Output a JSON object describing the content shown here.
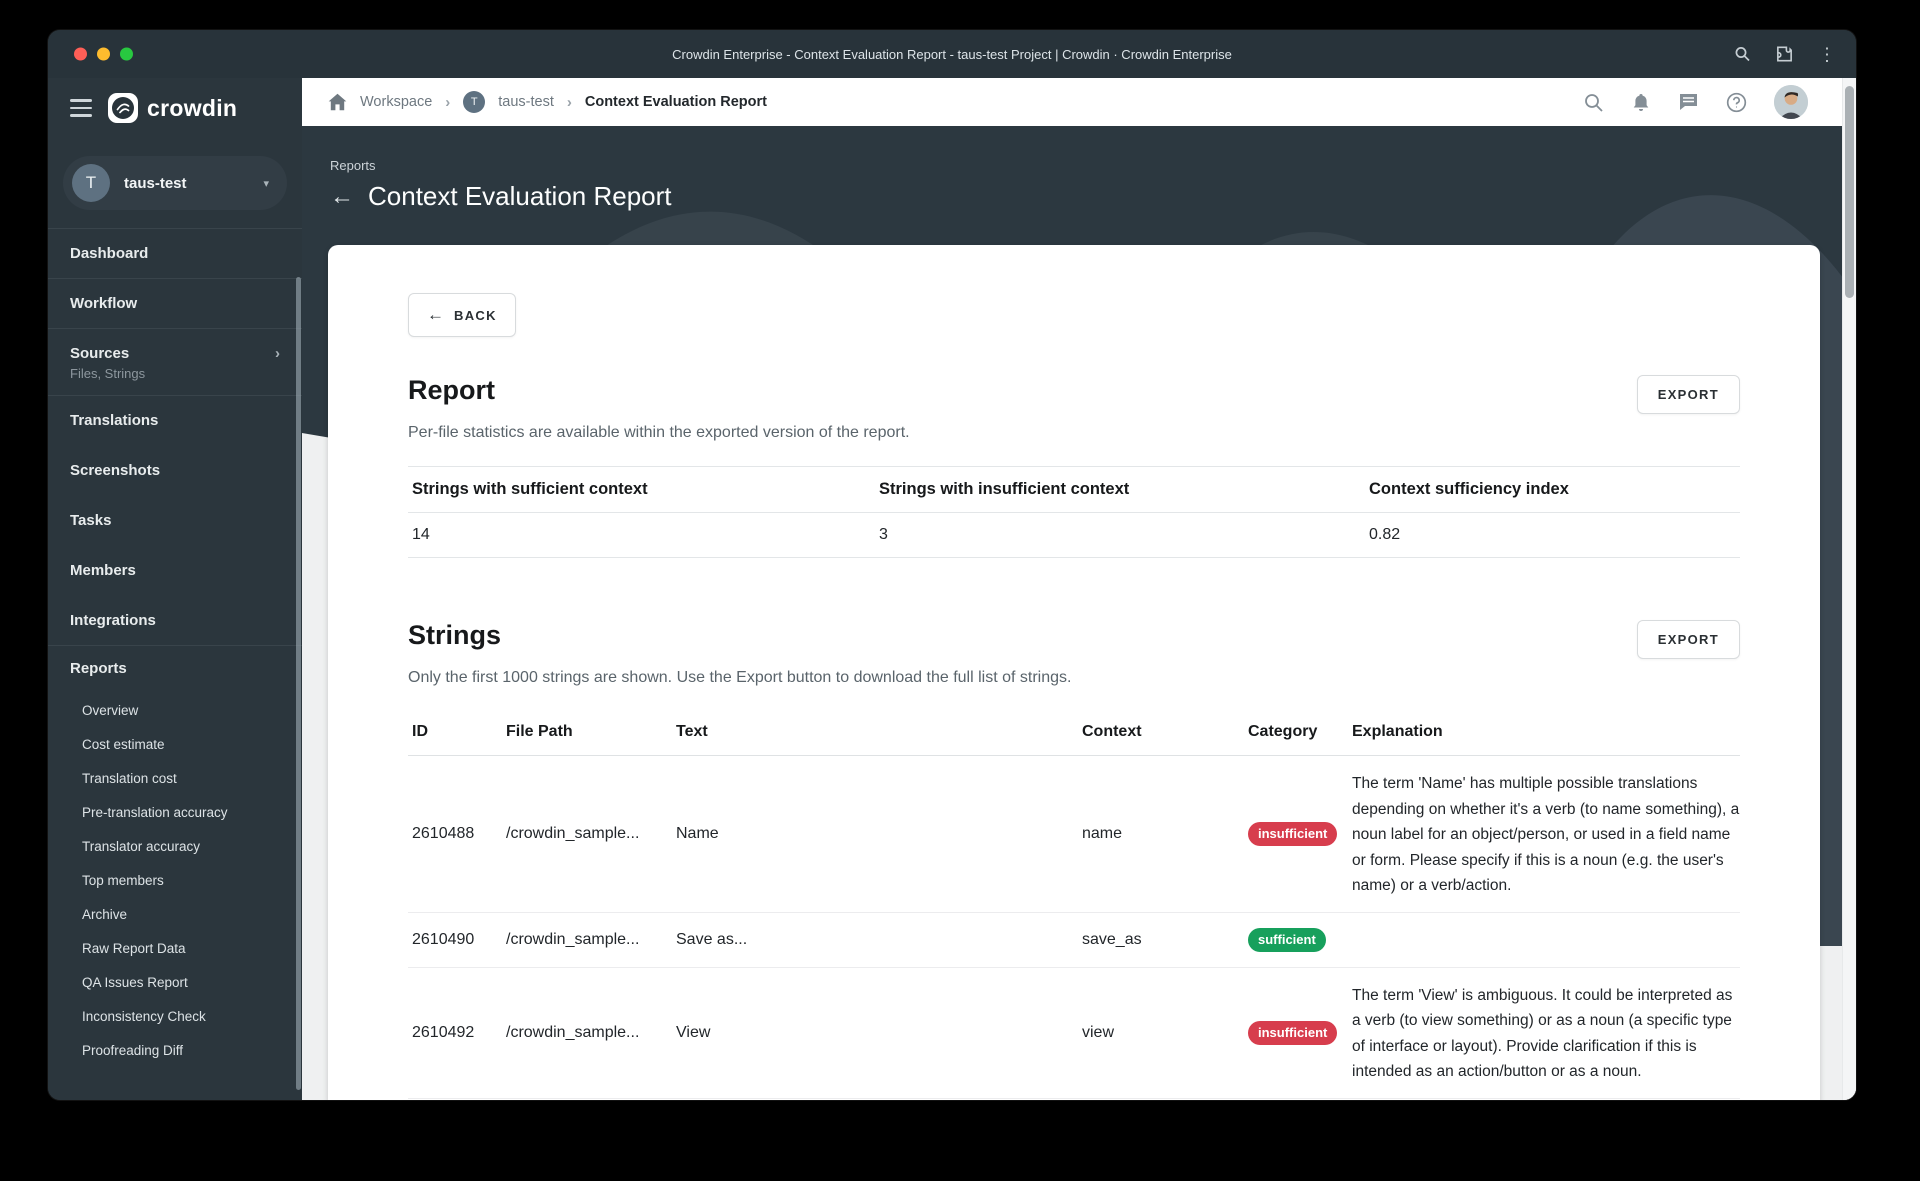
{
  "window": {
    "title": "Crowdin Enterprise - Context Evaluation Report - taus-test Project | Crowdin · Crowdin Enterprise"
  },
  "icons": {
    "kebab": "⋮",
    "caret_down": "▾",
    "chevron_right": "›",
    "back_arrow": "←"
  },
  "colors": {
    "titlebar_bg": "#28333a",
    "sidebar_bg": "#2b363d",
    "hero_bg": "#2c3840",
    "badge_insufficient": "#d73d4d",
    "badge_sufficient": "#17a05c"
  },
  "sidebar": {
    "brand": "crowdin",
    "project": {
      "initial": "T",
      "name": "taus-test"
    },
    "items": [
      {
        "label": "Dashboard"
      },
      {
        "label": "Workflow"
      },
      {
        "label": "Sources",
        "sublabel": "Files, Strings"
      },
      {
        "label": "Translations"
      },
      {
        "label": "Screenshots"
      },
      {
        "label": "Tasks"
      },
      {
        "label": "Members"
      },
      {
        "label": "Integrations"
      },
      {
        "label": "Reports"
      }
    ],
    "reports_children": [
      "Overview",
      "Cost estimate",
      "Translation cost",
      "Pre-translation accuracy",
      "Translator accuracy",
      "Top members",
      "Archive",
      "Raw Report Data",
      "QA Issues Report",
      "Inconsistency Check",
      "Proofreading Diff"
    ]
  },
  "topbar": {
    "breadcrumb": {
      "workspace": "Workspace",
      "project_initial": "T",
      "project": "taus-test",
      "page": "Context Evaluation Report"
    }
  },
  "page_header": {
    "eyebrow": "Reports",
    "title": "Context Evaluation Report"
  },
  "card": {
    "back_label": "BACK",
    "report": {
      "title": "Report",
      "export_label": "EXPORT",
      "description": "Per-file statistics are available within the exported version of the report.",
      "stats": [
        {
          "label": "Strings with sufficient context",
          "value": "14"
        },
        {
          "label": "Strings with insufficient context",
          "value": "3"
        },
        {
          "label": "Context sufficiency index",
          "value": "0.82"
        }
      ]
    },
    "strings": {
      "title": "Strings",
      "export_label": "EXPORT",
      "description": "Only the first 1000 strings are shown. Use the Export button to download the full list of strings.",
      "columns": [
        "ID",
        "File Path",
        "Text",
        "Context",
        "Category",
        "Explanation"
      ],
      "rows": [
        {
          "id": "2610488",
          "file_path": "/crowdin_sample...",
          "text": "Name",
          "context": "name",
          "category": "insufficient",
          "explanation": "The term 'Name' has multiple possible translations depending on whether it's a verb (to name something), a noun label for an object/person, or used in a field name or form. Please specify if this is a noun (e.g. the user's name) or a verb/action."
        },
        {
          "id": "2610490",
          "file_path": "/crowdin_sample...",
          "text": "Save as...",
          "context": "save_as",
          "category": "sufficient",
          "explanation": ""
        },
        {
          "id": "2610492",
          "file_path": "/crowdin_sample...",
          "text": "View",
          "context": "view",
          "category": "insufficient",
          "explanation": "The term 'View' is ambiguous. It could be interpreted as a verb (to view something) or as a noun (a specific type of interface or layout). Provide clarification if this is intended as an action/button or as a noun."
        }
      ]
    }
  }
}
